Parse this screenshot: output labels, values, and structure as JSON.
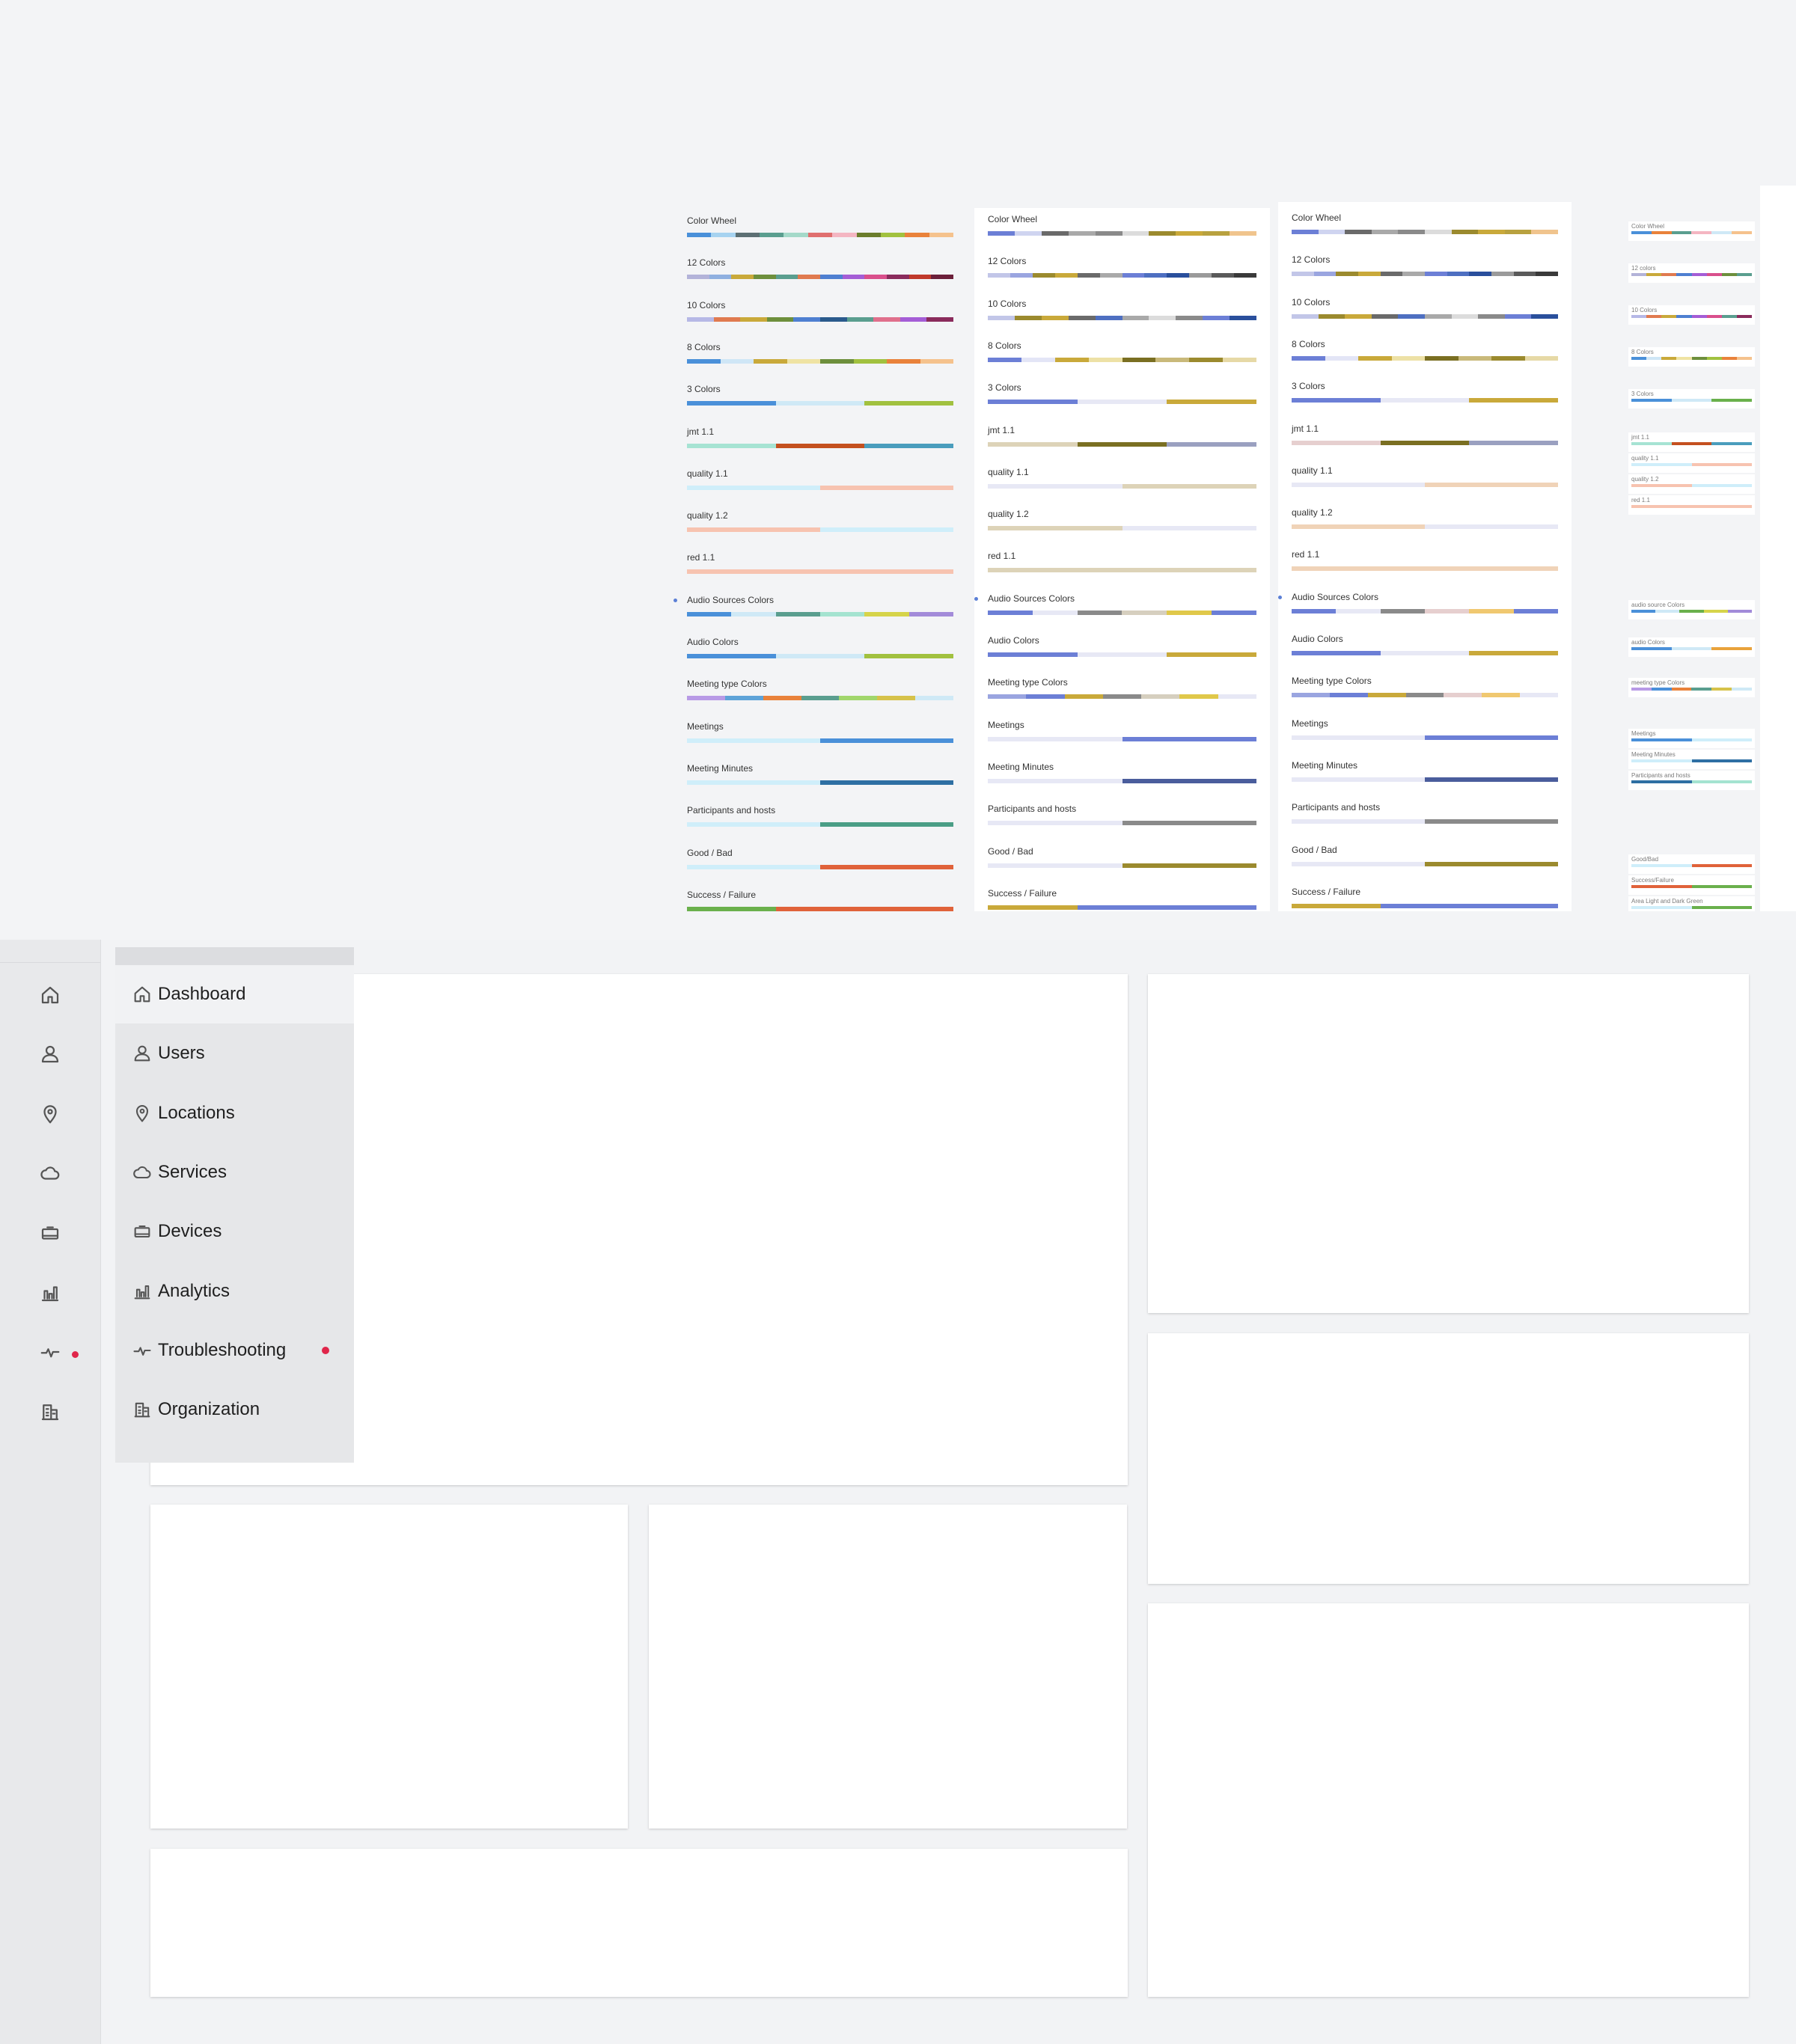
{
  "palette_columns": [
    {
      "rows": [
        {
          "label": "Color Wheel",
          "colors": [
            "#4a90d9",
            "#a7d3f0",
            "#5c6f73",
            "#5a9e8f",
            "#a4d9c9",
            "#e06f6f",
            "#f4b6c2",
            "#6b7d2c",
            "#a1c13f",
            "#e9823b",
            "#f5c28d"
          ]
        },
        {
          "label": "12 Colors",
          "colors": [
            "#b3b3d9",
            "#8fb0e0",
            "#c9a93a",
            "#6d8f3c",
            "#5a9e8f",
            "#e07a4f",
            "#4e7fd1",
            "#a45dd6",
            "#d94f8c",
            "#8a2b5c",
            "#c0392b",
            "#6b1f3a"
          ]
        },
        {
          "label": "10 Colors",
          "colors": [
            "#b6b8e6",
            "#e07a4f",
            "#c9a93a",
            "#6d8f3c",
            "#4e7fd1",
            "#2a5a8c",
            "#5a9e8f",
            "#e06f8c",
            "#a45dd6",
            "#8a2b5c"
          ]
        },
        {
          "label": "8 Colors",
          "colors": [
            "#4a90d9",
            "#cfe6f6",
            "#c9a93a",
            "#efe3a3",
            "#6d8f3c",
            "#a1c13f",
            "#e9823b",
            "#f5c28d"
          ]
        },
        {
          "label": "3 Colors",
          "colors": [
            "#4a90d9",
            "#cfe9f6",
            "#a1c13f"
          ]
        },
        {
          "label": "jmt 1.1",
          "colors": [
            "#a6e3d3",
            "#c4501f",
            "#4a9dbd"
          ]
        },
        {
          "label": "quality 1.1",
          "colors": [
            "#cfeefa",
            "#cfeefa",
            "#f7c3b0",
            "#f7c3b0"
          ]
        },
        {
          "label": "quality 1.2",
          "colors": [
            "#f7c3b0",
            "#f7c3b0",
            "#cfeefa",
            "#cfeefa"
          ]
        },
        {
          "label": "red 1.1",
          "colors": [
            "#f7c3b0"
          ]
        },
        {
          "label": "Audio Sources Colors",
          "colors": [
            "#4a90d9",
            "#cfe9f6",
            "#5a9e8f",
            "#a4e3d0",
            "#d6d44a",
            "#a28bd9"
          ],
          "dot": true
        },
        {
          "label": "Audio Colors",
          "colors": [
            "#4a90d9",
            "#cfe9f6",
            "#a1c13f"
          ]
        },
        {
          "label": "Meeting type Colors",
          "colors": [
            "#b89ae6",
            "#5ea3d8",
            "#e9823b",
            "#5a9e8f",
            "#a1d66c",
            "#d6c24a",
            "#cfe9f6"
          ]
        },
        {
          "label": "Meetings",
          "colors": [
            "#cfeefa",
            "#cfeefa",
            "#4a90d9",
            "#4a90d9"
          ]
        },
        {
          "label": "Meeting Minutes",
          "colors": [
            "#cfeefa",
            "#cfeefa",
            "#2e6fa3",
            "#2e6fa3"
          ]
        },
        {
          "label": "Participants and hosts",
          "colors": [
            "#cfeefa",
            "#cfeefa",
            "#4a9e86",
            "#4a9e86"
          ]
        },
        {
          "label": "Good / Bad",
          "colors": [
            "#cfeefa",
            "#cfeefa",
            "#e0623a",
            "#e0623a"
          ]
        },
        {
          "label": "Success / Failure",
          "colors": [
            "#6ab04c",
            "#e0623a",
            "#e0623a"
          ]
        }
      ]
    },
    {
      "rows": [
        {
          "label": "Color Wheel",
          "colors": [
            "#6c7fd6",
            "#cfd4f0",
            "#6a6a6a",
            "#a9a9a9",
            "#8a8a8a",
            "#dcdcdc",
            "#9b8a2e",
            "#c9a93a",
            "#b8a13f",
            "#f0c48d"
          ]
        },
        {
          "label": "12 Colors",
          "colors": [
            "#c2c6e8",
            "#9aa5e0",
            "#9b8a2e",
            "#c9a93a",
            "#6a6a6a",
            "#a9a9a9",
            "#6c7fd6",
            "#4e6fc1",
            "#2a4f9c",
            "#9a9a9a",
            "#5a5a5a",
            "#3a3a3a"
          ]
        },
        {
          "label": "10 Colors",
          "colors": [
            "#c2c6e8",
            "#9b8a2e",
            "#c9a93a",
            "#6a6a6a",
            "#4e6fc1",
            "#a9a9a9",
            "#dcdcdc",
            "#8a8a8a",
            "#6c7fd6",
            "#2a4f9c"
          ]
        },
        {
          "label": "8 Colors",
          "colors": [
            "#6c7fd6",
            "#e3e5f6",
            "#c9a93a",
            "#ede1a6",
            "#7a6f22",
            "#c9b97a",
            "#9b8a2e",
            "#e6d9a6"
          ]
        },
        {
          "label": "3 Colors",
          "colors": [
            "#6c7fd6",
            "#e7e8f5",
            "#c9a93a"
          ]
        },
        {
          "label": "jmt 1.1",
          "colors": [
            "#ddd3b8",
            "#7a6f22",
            "#9aa0c0"
          ]
        },
        {
          "label": "quality 1.1",
          "colors": [
            "#e7e8f5",
            "#e7e8f5",
            "#ddd3b8",
            "#ddd3b8"
          ]
        },
        {
          "label": "quality 1.2",
          "colors": [
            "#ddd3b8",
            "#ddd3b8",
            "#e7e8f5",
            "#e7e8f5"
          ]
        },
        {
          "label": "red 1.1",
          "colors": [
            "#ddd3b8"
          ]
        },
        {
          "label": "Audio Sources Colors",
          "colors": [
            "#6c7fd6",
            "#e7e8f5",
            "#8a8a8a",
            "#d6cfbf",
            "#e0c84a",
            "#6c7fd6"
          ],
          "dot": true
        },
        {
          "label": "Audio Colors",
          "colors": [
            "#6c7fd6",
            "#e7e8f5",
            "#c9a93a"
          ]
        },
        {
          "label": "Meeting type Colors",
          "colors": [
            "#9aa5e0",
            "#6c7fd6",
            "#c9a93a",
            "#8a8a8a",
            "#d6cfbf",
            "#e0c84a",
            "#e7e8f5"
          ]
        },
        {
          "label": "Meetings",
          "colors": [
            "#e7e8f5",
            "#e7e8f5",
            "#6c7fd6",
            "#6c7fd6"
          ]
        },
        {
          "label": "Meeting Minutes",
          "colors": [
            "#e7e8f5",
            "#e7e8f5",
            "#4a5d9c",
            "#4a5d9c"
          ]
        },
        {
          "label": "Participants and hosts",
          "colors": [
            "#e7e8f5",
            "#e7e8f5",
            "#8a8a8a",
            "#8a8a8a"
          ]
        },
        {
          "label": "Good / Bad",
          "colors": [
            "#e7e8f5",
            "#e7e8f5",
            "#9b8a2e",
            "#9b8a2e"
          ]
        },
        {
          "label": "Success / Failure",
          "colors": [
            "#c9a93a",
            "#6c7fd6",
            "#6c7fd6"
          ]
        }
      ]
    },
    {
      "rows": [
        {
          "label": "Color Wheel",
          "colors": [
            "#6c7fd6",
            "#cfd4f0",
            "#6a6a6a",
            "#a9a9a9",
            "#8a8a8a",
            "#dcdcdc",
            "#9b8a2e",
            "#c9a93a",
            "#b8a13f",
            "#f0c48d"
          ]
        },
        {
          "label": "12 Colors",
          "colors": [
            "#c2c6e8",
            "#9aa5e0",
            "#9b8a2e",
            "#c9a93a",
            "#6a6a6a",
            "#a9a9a9",
            "#6c7fd6",
            "#4e6fc1",
            "#2a4f9c",
            "#9a9a9a",
            "#5a5a5a",
            "#3a3a3a"
          ]
        },
        {
          "label": "10 Colors",
          "colors": [
            "#c2c6e8",
            "#9b8a2e",
            "#c9a93a",
            "#6a6a6a",
            "#4e6fc1",
            "#a9a9a9",
            "#dcdcdc",
            "#8a8a8a",
            "#6c7fd6",
            "#2a4f9c"
          ]
        },
        {
          "label": "8 Colors",
          "colors": [
            "#6c7fd6",
            "#e3e5f6",
            "#c9a93a",
            "#ede1a6",
            "#7a6f22",
            "#c9b97a",
            "#9b8a2e",
            "#e6d9a6"
          ]
        },
        {
          "label": "3 Colors",
          "colors": [
            "#6c7fd6",
            "#e7e8f5",
            "#c9a93a"
          ]
        },
        {
          "label": "jmt 1.1",
          "colors": [
            "#e6cfcf",
            "#7a6f22",
            "#9aa0c0"
          ]
        },
        {
          "label": "quality 1.1",
          "colors": [
            "#e7e8f5",
            "#e7e8f5",
            "#f0d3b8",
            "#f0d3b8"
          ]
        },
        {
          "label": "quality 1.2",
          "colors": [
            "#f0d3b8",
            "#f0d3b8",
            "#e7e8f5",
            "#e7e8f5"
          ]
        },
        {
          "label": "red 1.1",
          "colors": [
            "#f0d3b8"
          ]
        },
        {
          "label": "Audio Sources Colors",
          "colors": [
            "#6c7fd6",
            "#e7e8f5",
            "#8a8a8a",
            "#e6cfcf",
            "#f0c870",
            "#6c7fd6"
          ],
          "dot": true
        },
        {
          "label": "Audio Colors",
          "colors": [
            "#6c7fd6",
            "#e7e8f5",
            "#c9a93a"
          ]
        },
        {
          "label": "Meeting type Colors",
          "colors": [
            "#9aa5e0",
            "#6c7fd6",
            "#c9a93a",
            "#8a8a8a",
            "#e6cfcf",
            "#f0c870",
            "#e7e8f5"
          ]
        },
        {
          "label": "Meetings",
          "colors": [
            "#e7e8f5",
            "#e7e8f5",
            "#6c7fd6",
            "#6c7fd6"
          ]
        },
        {
          "label": "Meeting Minutes",
          "colors": [
            "#e7e8f5",
            "#e7e8f5",
            "#4a5d9c",
            "#4a5d9c"
          ]
        },
        {
          "label": "Participants and hosts",
          "colors": [
            "#e7e8f5",
            "#e7e8f5",
            "#8a8a8a",
            "#8a8a8a"
          ]
        },
        {
          "label": "Good / Bad",
          "colors": [
            "#e7e8f5",
            "#e7e8f5",
            "#9b8a2e",
            "#9b8a2e"
          ]
        },
        {
          "label": "Success / Failure",
          "colors": [
            "#c9a93a",
            "#6c7fd6",
            "#6c7fd6"
          ]
        }
      ]
    }
  ],
  "mini_column": {
    "rows": [
      {
        "label": "Color Wheel",
        "colors": [
          "#4a90d9",
          "#e9823b",
          "#5a9e8f",
          "#f4b6c2",
          "#cfe9f6",
          "#f5c28d"
        ]
      },
      {
        "label": "12 colors",
        "colors": [
          "#b3b3d9",
          "#c9a93a",
          "#e07a4f",
          "#4e7fd1",
          "#a45dd6",
          "#d94f8c",
          "#6d8f3c",
          "#5a9e8f"
        ]
      },
      {
        "label": "10 Colors",
        "colors": [
          "#b6b8e6",
          "#e07a4f",
          "#c9a93a",
          "#4e7fd1",
          "#a45dd6",
          "#d94f8c",
          "#5a9e8f",
          "#8a2b5c"
        ]
      },
      {
        "label": "8 Colors",
        "colors": [
          "#4a90d9",
          "#cfe6f6",
          "#c9a93a",
          "#efe3a3",
          "#6d8f3c",
          "#a1c13f",
          "#e9823b",
          "#f5c28d"
        ]
      },
      {
        "label": "3 Colors",
        "colors": [
          "#4a90d9",
          "#cfe9f6",
          "#6ab04c"
        ]
      },
      {
        "label": "jmt 1.1",
        "colors": [
          "#a6e3d3",
          "#c4501f",
          "#4a9dbd"
        ]
      },
      {
        "label": "quality 1.1",
        "colors": [
          "#cfeefa",
          "#f7c3b0"
        ]
      },
      {
        "label": "quality 1.2",
        "colors": [
          "#f7c3b0",
          "#cfeefa"
        ]
      },
      {
        "label": "red 1.1",
        "colors": [
          "#f7c3b0"
        ]
      },
      {
        "label": "audio source Colors",
        "colors": [
          "#4a90d9",
          "#cfe9f6",
          "#6ab04c",
          "#d6d44a",
          "#a28bd9"
        ]
      },
      {
        "label": "audio Colors",
        "colors": [
          "#4a90d9",
          "#cfe9f6",
          "#e9a23b"
        ]
      },
      {
        "label": "meeting type Colors",
        "colors": [
          "#b89ae6",
          "#4a90d9",
          "#e9823b",
          "#5a9e8f",
          "#d6c24a",
          "#cfe9f6"
        ]
      },
      {
        "label": "Meetings",
        "colors": [
          "#4a90d9",
          "#cfeefa"
        ]
      },
      {
        "label": "Meeting Minutes",
        "colors": [
          "#cfeefa",
          "#2e6fa3"
        ]
      },
      {
        "label": "Participants and hosts",
        "colors": [
          "#2e6fa3",
          "#a4e3d0"
        ]
      },
      {
        "label": "Good/Bad",
        "colors": [
          "#cfeefa",
          "#e0623a"
        ]
      },
      {
        "label": "Success/Failure",
        "colors": [
          "#e0623a",
          "#6ab04c"
        ]
      },
      {
        "label": "Area Light and Dark Green",
        "colors": [
          "#cfeefa",
          "#6ab04c"
        ]
      }
    ]
  },
  "nav": {
    "items": [
      {
        "label": "Dashboard",
        "icon": "home-icon"
      },
      {
        "label": "Users",
        "icon": "user-icon"
      },
      {
        "label": "Locations",
        "icon": "location-pin-icon"
      },
      {
        "label": "Services",
        "icon": "cloud-icon"
      },
      {
        "label": "Devices",
        "icon": "device-icon"
      },
      {
        "label": "Analytics",
        "icon": "bar-chart-icon"
      },
      {
        "label": "Troubleshooting",
        "icon": "pulse-icon",
        "alert": true
      },
      {
        "label": "Organization",
        "icon": "building-icon"
      }
    ],
    "active_index": 0,
    "alert_color": "#e0264a"
  }
}
